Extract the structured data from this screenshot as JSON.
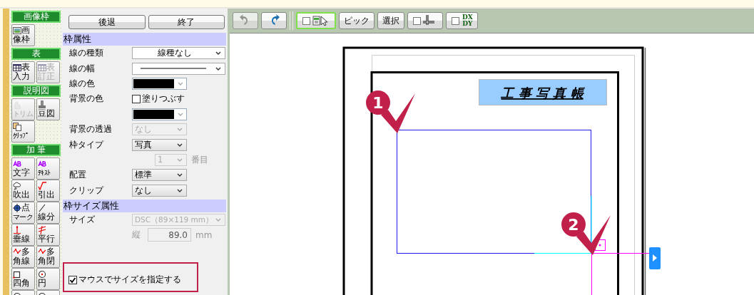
{
  "palette": [
    {
      "title": "画像枠",
      "buttons": [
        {
          "kind": "image",
          "top": "画",
          "label": "像枠",
          "disabled": false
        }
      ]
    },
    {
      "title": "表",
      "buttons": [
        {
          "kind": "table",
          "top": "表",
          "label": "入力",
          "disabled": false
        },
        {
          "kind": "table",
          "top": "表",
          "label": "訂正",
          "disabled": true
        }
      ]
    },
    {
      "title": "説明図",
      "buttons": [
        {
          "kind": "trim",
          "label": "トリム",
          "disabled": true
        },
        {
          "kind": "stamp",
          "label": "豆図",
          "disabled": false
        },
        {
          "kind": "clip",
          "label": "ｸﾘｯﾌﾟ",
          "disabled": false
        }
      ]
    },
    {
      "title": "加 筆",
      "buttons": [
        {
          "kind": "ab",
          "label": "文字",
          "disabled": false
        },
        {
          "kind": "ab",
          "label": "ﾃｷｽﾄ",
          "disabled": false
        },
        {
          "kind": "cloud",
          "label": "吹出",
          "disabled": false
        },
        {
          "kind": "leader",
          "label": "引出",
          "disabled": false
        },
        {
          "kind": "marker",
          "top": "点",
          "label": "マーク",
          "disabled": false
        },
        {
          "kind": "line",
          "label": "線分",
          "disabled": false
        },
        {
          "kind": "perp",
          "label": "垂線",
          "disabled": false
        },
        {
          "kind": "parallel",
          "label": "平行",
          "disabled": false
        },
        {
          "kind": "poly",
          "top": "多",
          "label": "角線",
          "disabled": false
        },
        {
          "kind": "poly",
          "top": "多",
          "label": "角閉",
          "disabled": false
        },
        {
          "kind": "rect",
          "label": "四角",
          "disabled": false
        },
        {
          "kind": "circle",
          "label": "円",
          "disabled": false
        },
        {
          "kind": "circle"
        },
        {
          "kind": "circle"
        }
      ]
    }
  ],
  "panel": {
    "buttons": [
      "後退",
      "終了"
    ],
    "sections": [
      {
        "title": "枠属性",
        "rows": [
          {
            "kind": "wide_select",
            "label": "線の種類",
            "value": "線種なし",
            "disabled": false
          },
          {
            "kind": "line_select",
            "label": "線の幅"
          },
          {
            "kind": "color",
            "label": "線の色",
            "color": "#000000"
          },
          {
            "kind": "checkbox",
            "label": "背景の色",
            "text": "塗りつぶす",
            "checked": false
          },
          {
            "kind": "color",
            "color": "#000000"
          },
          {
            "kind": "select",
            "label": "背景の透過",
            "value": "なし",
            "disabled": true
          },
          {
            "kind": "select",
            "label": "枠タイプ",
            "value": "写真",
            "disabled": false
          },
          {
            "kind": "counter",
            "value": "1",
            "suffix": "番目",
            "disabled": true
          },
          {
            "kind": "select",
            "label": "配置",
            "value": "標準",
            "disabled": false
          },
          {
            "kind": "select",
            "label": "クリップ",
            "value": "なし",
            "disabled": false
          }
        ]
      },
      {
        "title": "枠サイズ属性",
        "rows": [
          {
            "kind": "wide_select",
            "label": "サイズ",
            "value": "DSC（89×119 mm）",
            "disabled": true
          },
          {
            "kind": "number",
            "label": "縦",
            "value": "89.0",
            "unit": "mm",
            "disabled": true
          }
        ]
      }
    ],
    "overlay_checkbox": {
      "text": "マウスでサイズを指定する",
      "checked": true
    }
  },
  "toolbar": [
    {
      "kind": "undo",
      "selected": false,
      "disabled": true
    },
    {
      "kind": "redo",
      "selected": false,
      "disabled": false
    },
    {
      "kind": "separator"
    },
    {
      "kind": "frame_toggle",
      "selected": true,
      "disabled": false
    },
    {
      "kind": "text",
      "label": "ピック",
      "selected": false,
      "disabled": false
    },
    {
      "kind": "text",
      "label": "選択",
      "selected": false,
      "disabled": false
    },
    {
      "kind": "ruler_toggle",
      "selected": false,
      "disabled": false
    },
    {
      "kind": "dxdy",
      "lines": [
        "DX",
        "DY"
      ],
      "selected": false,
      "disabled": false
    }
  ],
  "canvas": {
    "title": "工 事 写 真 帳",
    "markers": [
      "1",
      "2"
    ]
  }
}
